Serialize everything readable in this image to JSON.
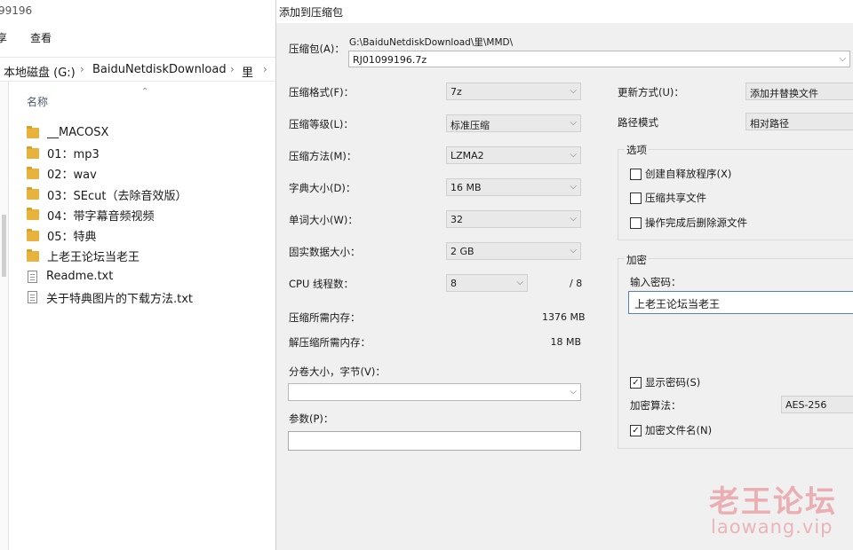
{
  "explorer": {
    "title_fragment": "99196",
    "ribbon": [
      "享",
      "查看"
    ],
    "address": [
      "本地磁盘 (G:)",
      "BaiduNetdiskDownload",
      "里"
    ],
    "column_name": "名称",
    "files": [
      {
        "name": "__MACOSX",
        "type": "folder"
      },
      {
        "name": "01：mp3",
        "type": "folder"
      },
      {
        "name": "02：wav",
        "type": "folder"
      },
      {
        "name": "03：SEcut（去除音效版）",
        "type": "folder"
      },
      {
        "name": "04：带字幕音频视频",
        "type": "folder"
      },
      {
        "name": "05：特典",
        "type": "folder"
      },
      {
        "name": "上老王论坛当老王",
        "type": "folder"
      },
      {
        "name": "Readme.txt",
        "type": "text"
      },
      {
        "name": "关于特典图片的下载方法.txt",
        "type": "text"
      }
    ]
  },
  "dialog": {
    "title": "添加到压缩包",
    "archive_label": "压缩包(A)：",
    "archive_path": "G:\\BaiduNetdiskDownload\\里\\MMD\\",
    "archive_name": "RJ01099196.7z",
    "format_label": "压缩格式(F)：",
    "format_value": "7z",
    "level_label": "压缩等级(L)：",
    "level_value": "标准压缩",
    "method_label": "压缩方法(M)：",
    "method_value": "LZMA2",
    "dict_label": "字典大小(D)：",
    "dict_value": "16 MB",
    "word_label": "单词大小(W)：",
    "word_value": "32",
    "solid_label": "固实数据大小：",
    "solid_value": "2 GB",
    "cpu_label": "CPU 线程数：",
    "cpu_value": "8",
    "cpu_total": "/ 8",
    "mem_comp_label": "压缩所需内存：",
    "mem_comp_value": "1376 MB",
    "mem_decomp_label": "解压缩所需内存：",
    "mem_decomp_value": "18 MB",
    "split_label": "分卷大小，字节(V)：",
    "split_value": "",
    "params_label": "参数(P)：",
    "params_value": "",
    "update_label": "更新方式(U)：",
    "update_value": "添加并替换文件",
    "path_label": "路径模式",
    "path_value": "相对路径",
    "options_title": "选项",
    "opt_sfx": "创建自释放程序(X)",
    "opt_shared": "压缩共享文件",
    "opt_delete": "操作完成后删除源文件",
    "encrypt_title": "加密",
    "password_label": "输入密码：",
    "password_value": "上老王论坛当老王",
    "show_password": "显示密码(S)",
    "enc_method_label": "加密算法：",
    "enc_method_value": "AES-256",
    "enc_names": "加密文件名(N)",
    "check_mark": "✓"
  },
  "watermark": {
    "cn": "老王论坛",
    "url": "laowang.vip"
  }
}
